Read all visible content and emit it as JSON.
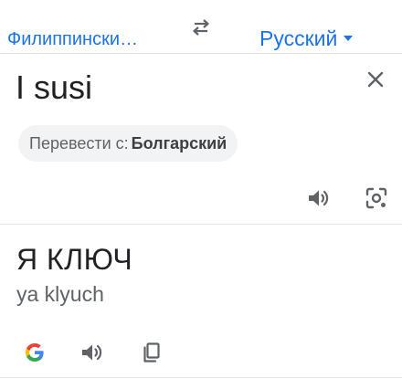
{
  "language_bar": {
    "source_language": "Филиппински…",
    "target_language": "Русский"
  },
  "input": {
    "text": "I susi"
  },
  "detect_chip": {
    "prefix": "Перевести с:",
    "language": "Болгарский"
  },
  "result": {
    "translation": "Я КЛЮЧ",
    "transliteration": "ya klyuch"
  },
  "colors": {
    "accent": "#1a73e8",
    "icon": "#5f6368",
    "chip_bg": "#f1f3f4"
  },
  "icons": [
    "swap-languages-icon",
    "chevron-down-icon",
    "close-icon",
    "speaker-icon",
    "camera-lens-icon",
    "google-logo-icon",
    "copy-icon"
  ]
}
